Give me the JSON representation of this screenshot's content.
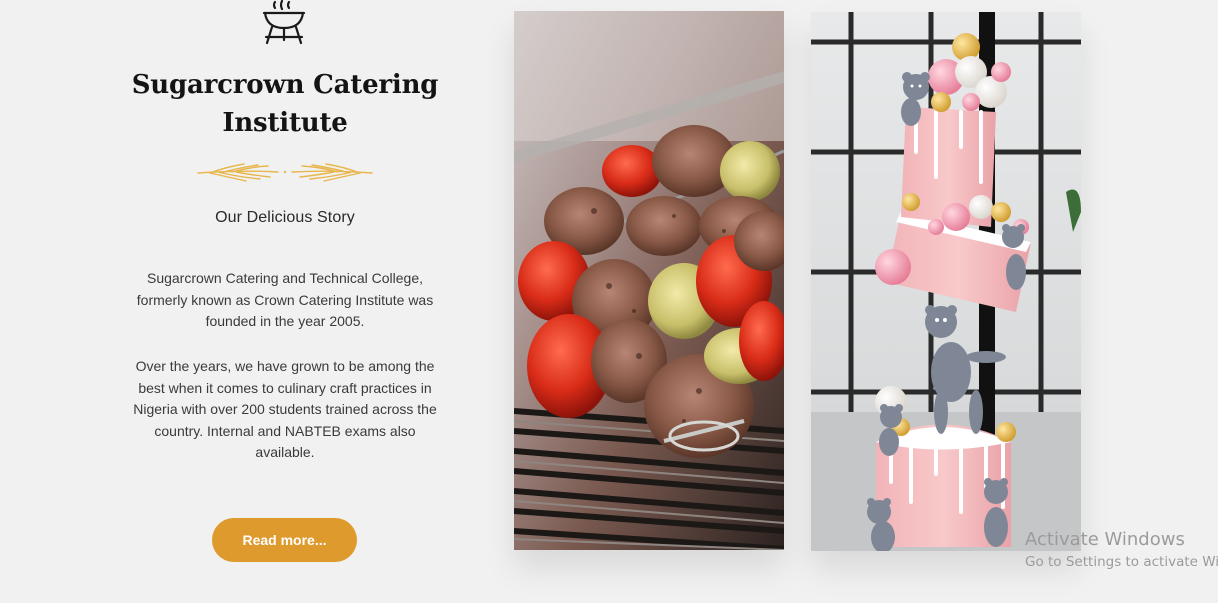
{
  "story": {
    "icon": "grill-icon",
    "title_line1": "Sugarcrown Catering",
    "title_line2": "Institute",
    "divider_icon": "wheat-divider-icon",
    "subtitle": "Our Delicious Story",
    "paragraph1": "Sugarcrown Catering and Technical College, formerly known as Crown Catering Institute was founded in the year 2005.",
    "paragraph2": "Over the years, we have grown to be among the best when it comes to culinary craft practices in Nigeria with over 200 students trained across the country. Internal and NABTEB exams also available.",
    "button_label": "Read more..."
  },
  "gallery": [
    {
      "name": "kebab-skewers-photo"
    },
    {
      "name": "teddy-bear-cake-photo"
    }
  ],
  "watermark": {
    "title": "Activate Windows",
    "subtitle": "Go to Settings to activate Windows."
  },
  "colors": {
    "background": "#f1f1f1",
    "accent": "#df9a2d",
    "divider": "#e8b64c",
    "heading": "#141414"
  }
}
